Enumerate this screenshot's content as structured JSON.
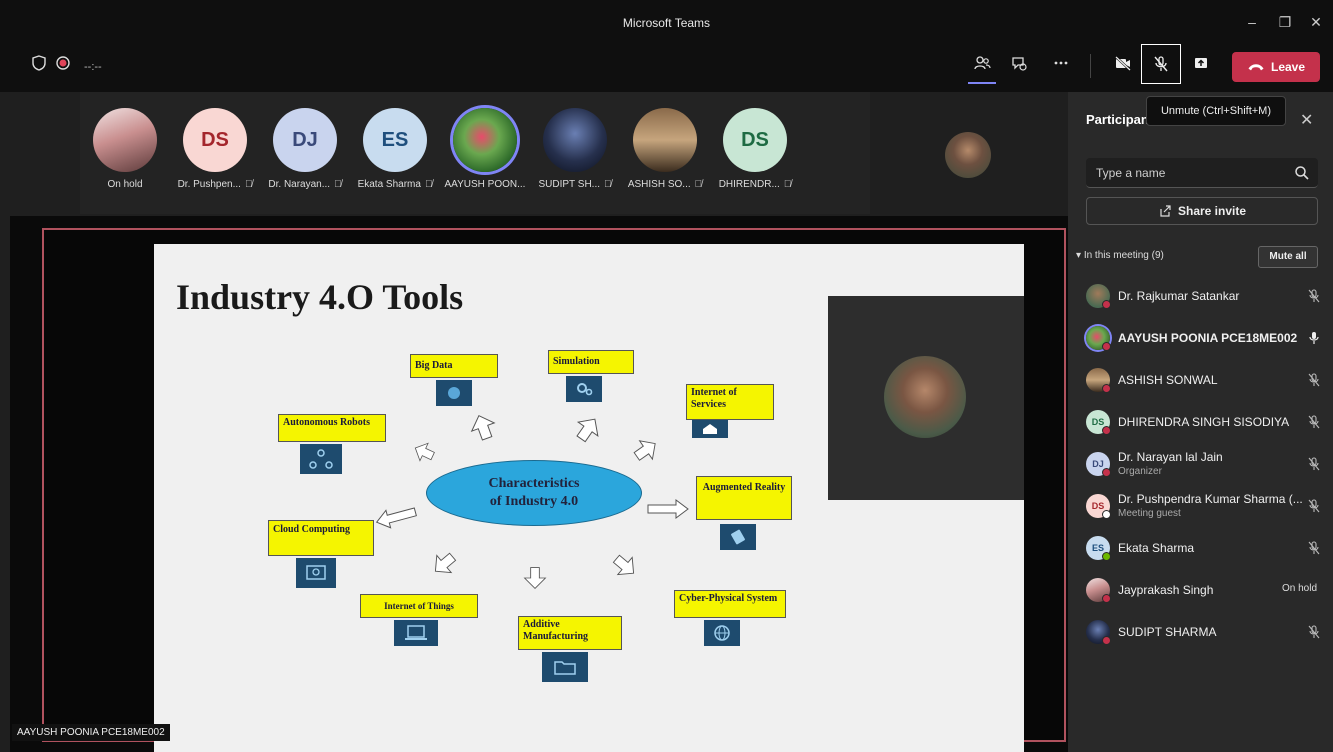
{
  "window": {
    "title": "Microsoft Teams"
  },
  "toolbar": {
    "timer": "--:--",
    "leave_label": "Leave",
    "tooltip": "Unmute (Ctrl+Shift+M)"
  },
  "strip": {
    "participants": [
      {
        "label": "On hold",
        "initials": "",
        "muted": false
      },
      {
        "label": "Dr. Pushpen...",
        "initials": "DS",
        "muted": true
      },
      {
        "label": "Dr. Narayan...",
        "initials": "DJ",
        "muted": true
      },
      {
        "label": "Ekata Sharma",
        "initials": "ES",
        "muted": true
      },
      {
        "label": "AAYUSH POON...",
        "initials": "",
        "muted": false
      },
      {
        "label": "SUDIPT SH...",
        "initials": "",
        "muted": true
      },
      {
        "label": "ASHISH SO...",
        "initials": "",
        "muted": true
      },
      {
        "label": "DHIRENDR...",
        "initials": "DS",
        "muted": true
      }
    ]
  },
  "slide": {
    "title": "Industry 4.O Tools",
    "center_line1": "Characteristics",
    "center_line2": "of Industry 4.0",
    "items": {
      "big_data": "Big Data",
      "simulation": "Simulation",
      "internet_of_services": "Internet of Services",
      "autonomous_robots": "Autonomous Robots",
      "augmented_reality": "Augmented Reality",
      "cloud_computing": "Cloud Computing",
      "cyber_physical": "Cyber-Physical System",
      "internet_of_things": "Internet of Things",
      "additive_manufacturing": "Additive Manufacturing"
    }
  },
  "share": {
    "presenter_label": "AAYUSH POONIA PCE18ME002"
  },
  "panel": {
    "title": "Participants",
    "search_placeholder": "Type a name",
    "share_invite": "Share invite",
    "section": "In this meeting (9)",
    "mute_all": "Mute all",
    "people": [
      {
        "name": "Dr. Rajkumar Satankar",
        "initials": "",
        "role": "",
        "status": "muted"
      },
      {
        "name": "AAYUSH POONIA PCE18ME002",
        "initials": "",
        "role": "",
        "status": "mic"
      },
      {
        "name": "ASHISH SONWAL",
        "initials": "",
        "role": "",
        "status": "muted"
      },
      {
        "name": "DHIRENDRA SINGH SISODIYA",
        "initials": "DS",
        "role": "",
        "status": "muted"
      },
      {
        "name": "Dr. Narayan lal Jain",
        "initials": "DJ",
        "role": "Organizer",
        "status": "muted"
      },
      {
        "name": "Dr. Pushpendra Kumar Sharma (...",
        "initials": "DS",
        "role": "Meeting guest",
        "status": "muted"
      },
      {
        "name": "Ekata Sharma",
        "initials": "ES",
        "role": "",
        "status": "muted"
      },
      {
        "name": "Jayprakash Singh",
        "initials": "",
        "role": "",
        "status": "On hold"
      },
      {
        "name": "SUDIPT SHARMA",
        "initials": "",
        "role": "",
        "status": "muted"
      }
    ]
  },
  "colors": {
    "leave": "#c4314b",
    "slide_box": "#f5f500",
    "ellipse": "#2ba6dc",
    "share_border": "#b0525e"
  }
}
